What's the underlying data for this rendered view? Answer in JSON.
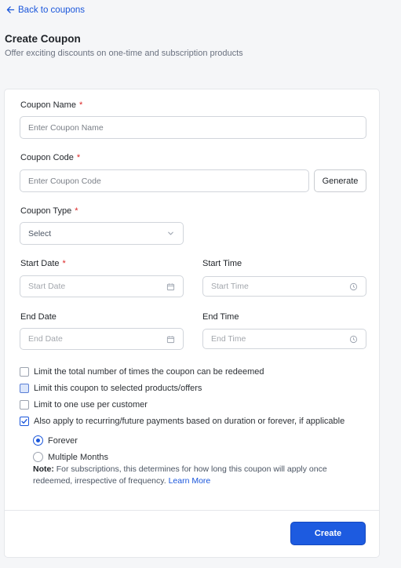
{
  "nav": {
    "back_label": "Back to coupons"
  },
  "header": {
    "title": "Create Coupon",
    "subtitle": "Offer exciting discounts on one-time and subscription products"
  },
  "form": {
    "coupon_name": {
      "label": "Coupon Name",
      "required": "*",
      "placeholder": "Enter Coupon Name"
    },
    "coupon_code": {
      "label": "Coupon Code",
      "required": "*",
      "placeholder": "Enter Coupon Code",
      "generate_label": "Generate"
    },
    "coupon_type": {
      "label": "Coupon Type",
      "required": "*",
      "value": "Select"
    },
    "start_date": {
      "label": "Start Date",
      "required": "*",
      "placeholder": "Start Date"
    },
    "start_time": {
      "label": "Start Time",
      "placeholder": "Start Time"
    },
    "end_date": {
      "label": "End Date",
      "placeholder": "End Date"
    },
    "end_time": {
      "label": "End Time",
      "placeholder": "End Time"
    },
    "options": [
      {
        "label": "Limit the total number of times the coupon can be redeemed",
        "checked": false
      },
      {
        "label": "Limit this coupon to selected products/offers",
        "checked": false
      },
      {
        "label": "Limit to one use per customer",
        "checked": false
      },
      {
        "label": "Also apply to recurring/future payments based on duration or forever, if applicable",
        "checked": true
      }
    ],
    "duration": [
      {
        "label": "Forever",
        "selected": true
      },
      {
        "label": "Multiple Months",
        "selected": false
      }
    ],
    "note": {
      "prefix": "Note:",
      "text": "For subscriptions, this determines for how long this coupon will apply once redeemed, irrespective of frequency.",
      "link": "Learn More"
    },
    "submit_label": "Create"
  },
  "colors": {
    "accent": "#1d5be0",
    "required": "#dc2626",
    "link": "#1a56db"
  }
}
